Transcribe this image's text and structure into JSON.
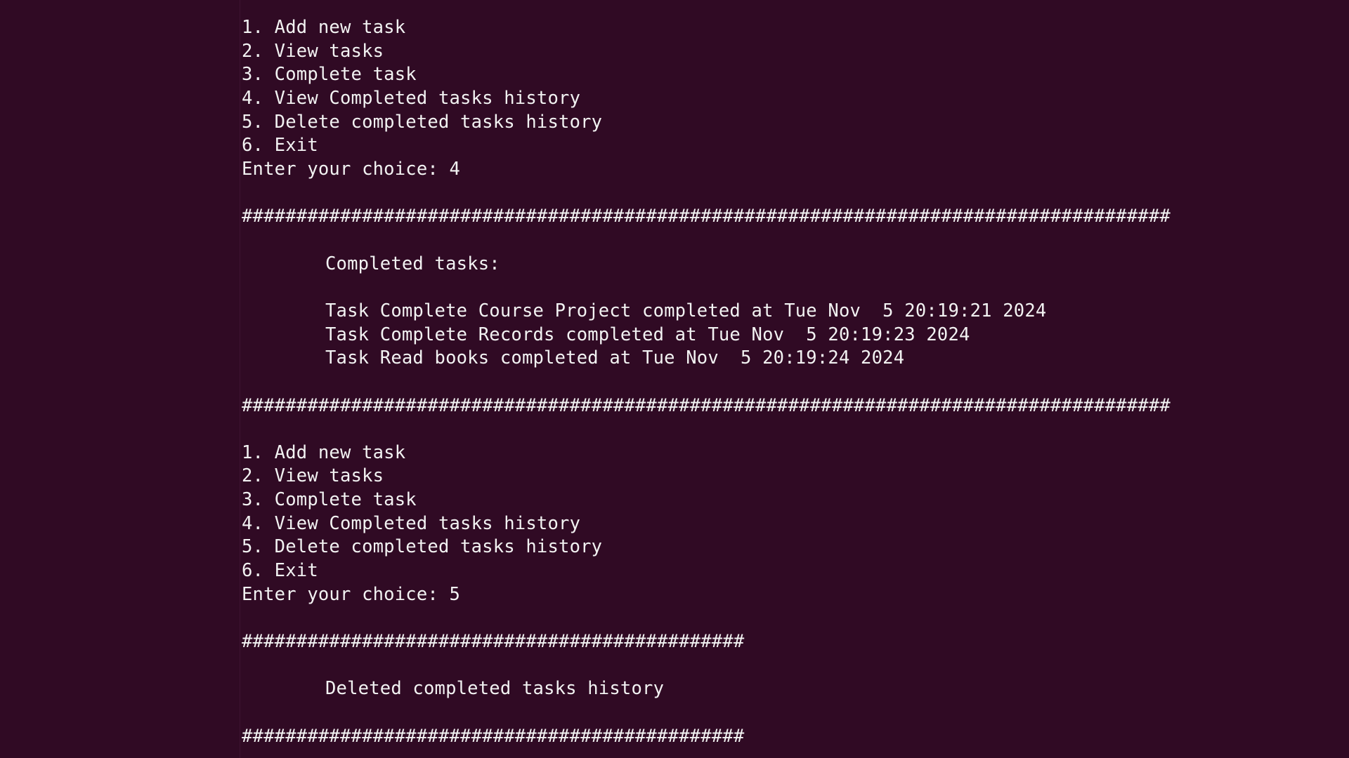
{
  "terminal": {
    "block1": {
      "menu": [
        "1. Add new task",
        "2. View tasks",
        "3. Complete task",
        "4. View Completed tasks history",
        "5. Delete completed tasks history",
        "6. Exit"
      ],
      "prompt": "Enter your choice: 4"
    },
    "separator_long": "#####################################################################################",
    "completed": {
      "heading": "Completed tasks:",
      "tasks": [
        "Task Complete Course Project completed at Tue Nov  5 20:19:21 2024",
        "Task Complete Records completed at Tue Nov  5 20:19:23 2024",
        "Task Read books completed at Tue Nov  5 20:19:24 2024"
      ]
    },
    "block2": {
      "menu": [
        "1. Add new task",
        "2. View tasks",
        "3. Complete task",
        "4. View Completed tasks history",
        "5. Delete completed tasks history",
        "6. Exit"
      ],
      "prompt": "Enter your choice: 5"
    },
    "separator_short": "##############################################",
    "deleted_message": "Deleted completed tasks history"
  },
  "colors": {
    "background": "#300a24",
    "foreground": "#f2f2f2"
  }
}
